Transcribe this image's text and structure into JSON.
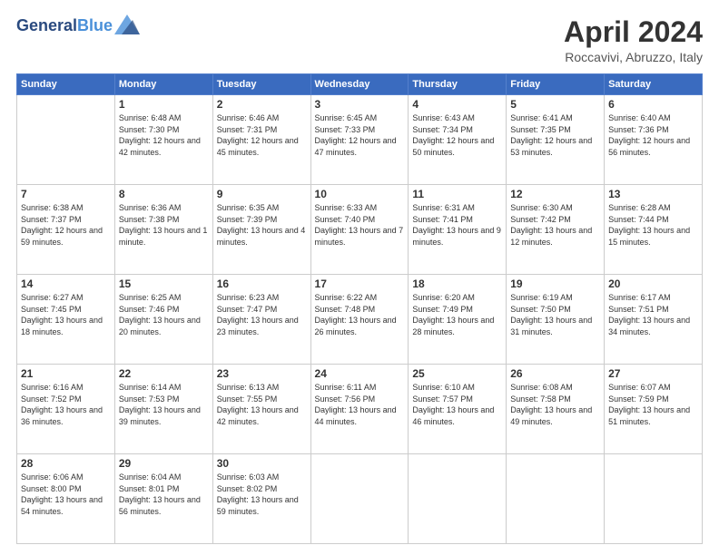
{
  "header": {
    "logo_line1": "General",
    "logo_line2": "Blue",
    "title": "April 2024",
    "location": "Roccavivi, Abruzzo, Italy"
  },
  "weekdays": [
    "Sunday",
    "Monday",
    "Tuesday",
    "Wednesday",
    "Thursday",
    "Friday",
    "Saturday"
  ],
  "weeks": [
    [
      {
        "day": "",
        "sunrise": "",
        "sunset": "",
        "daylight": ""
      },
      {
        "day": "1",
        "sunrise": "Sunrise: 6:48 AM",
        "sunset": "Sunset: 7:30 PM",
        "daylight": "Daylight: 12 hours and 42 minutes."
      },
      {
        "day": "2",
        "sunrise": "Sunrise: 6:46 AM",
        "sunset": "Sunset: 7:31 PM",
        "daylight": "Daylight: 12 hours and 45 minutes."
      },
      {
        "day": "3",
        "sunrise": "Sunrise: 6:45 AM",
        "sunset": "Sunset: 7:33 PM",
        "daylight": "Daylight: 12 hours and 47 minutes."
      },
      {
        "day": "4",
        "sunrise": "Sunrise: 6:43 AM",
        "sunset": "Sunset: 7:34 PM",
        "daylight": "Daylight: 12 hours and 50 minutes."
      },
      {
        "day": "5",
        "sunrise": "Sunrise: 6:41 AM",
        "sunset": "Sunset: 7:35 PM",
        "daylight": "Daylight: 12 hours and 53 minutes."
      },
      {
        "day": "6",
        "sunrise": "Sunrise: 6:40 AM",
        "sunset": "Sunset: 7:36 PM",
        "daylight": "Daylight: 12 hours and 56 minutes."
      }
    ],
    [
      {
        "day": "7",
        "sunrise": "Sunrise: 6:38 AM",
        "sunset": "Sunset: 7:37 PM",
        "daylight": "Daylight: 12 hours and 59 minutes."
      },
      {
        "day": "8",
        "sunrise": "Sunrise: 6:36 AM",
        "sunset": "Sunset: 7:38 PM",
        "daylight": "Daylight: 13 hours and 1 minute."
      },
      {
        "day": "9",
        "sunrise": "Sunrise: 6:35 AM",
        "sunset": "Sunset: 7:39 PM",
        "daylight": "Daylight: 13 hours and 4 minutes."
      },
      {
        "day": "10",
        "sunrise": "Sunrise: 6:33 AM",
        "sunset": "Sunset: 7:40 PM",
        "daylight": "Daylight: 13 hours and 7 minutes."
      },
      {
        "day": "11",
        "sunrise": "Sunrise: 6:31 AM",
        "sunset": "Sunset: 7:41 PM",
        "daylight": "Daylight: 13 hours and 9 minutes."
      },
      {
        "day": "12",
        "sunrise": "Sunrise: 6:30 AM",
        "sunset": "Sunset: 7:42 PM",
        "daylight": "Daylight: 13 hours and 12 minutes."
      },
      {
        "day": "13",
        "sunrise": "Sunrise: 6:28 AM",
        "sunset": "Sunset: 7:44 PM",
        "daylight": "Daylight: 13 hours and 15 minutes."
      }
    ],
    [
      {
        "day": "14",
        "sunrise": "Sunrise: 6:27 AM",
        "sunset": "Sunset: 7:45 PM",
        "daylight": "Daylight: 13 hours and 18 minutes."
      },
      {
        "day": "15",
        "sunrise": "Sunrise: 6:25 AM",
        "sunset": "Sunset: 7:46 PM",
        "daylight": "Daylight: 13 hours and 20 minutes."
      },
      {
        "day": "16",
        "sunrise": "Sunrise: 6:23 AM",
        "sunset": "Sunset: 7:47 PM",
        "daylight": "Daylight: 13 hours and 23 minutes."
      },
      {
        "day": "17",
        "sunrise": "Sunrise: 6:22 AM",
        "sunset": "Sunset: 7:48 PM",
        "daylight": "Daylight: 13 hours and 26 minutes."
      },
      {
        "day": "18",
        "sunrise": "Sunrise: 6:20 AM",
        "sunset": "Sunset: 7:49 PM",
        "daylight": "Daylight: 13 hours and 28 minutes."
      },
      {
        "day": "19",
        "sunrise": "Sunrise: 6:19 AM",
        "sunset": "Sunset: 7:50 PM",
        "daylight": "Daylight: 13 hours and 31 minutes."
      },
      {
        "day": "20",
        "sunrise": "Sunrise: 6:17 AM",
        "sunset": "Sunset: 7:51 PM",
        "daylight": "Daylight: 13 hours and 34 minutes."
      }
    ],
    [
      {
        "day": "21",
        "sunrise": "Sunrise: 6:16 AM",
        "sunset": "Sunset: 7:52 PM",
        "daylight": "Daylight: 13 hours and 36 minutes."
      },
      {
        "day": "22",
        "sunrise": "Sunrise: 6:14 AM",
        "sunset": "Sunset: 7:53 PM",
        "daylight": "Daylight: 13 hours and 39 minutes."
      },
      {
        "day": "23",
        "sunrise": "Sunrise: 6:13 AM",
        "sunset": "Sunset: 7:55 PM",
        "daylight": "Daylight: 13 hours and 42 minutes."
      },
      {
        "day": "24",
        "sunrise": "Sunrise: 6:11 AM",
        "sunset": "Sunset: 7:56 PM",
        "daylight": "Daylight: 13 hours and 44 minutes."
      },
      {
        "day": "25",
        "sunrise": "Sunrise: 6:10 AM",
        "sunset": "Sunset: 7:57 PM",
        "daylight": "Daylight: 13 hours and 46 minutes."
      },
      {
        "day": "26",
        "sunrise": "Sunrise: 6:08 AM",
        "sunset": "Sunset: 7:58 PM",
        "daylight": "Daylight: 13 hours and 49 minutes."
      },
      {
        "day": "27",
        "sunrise": "Sunrise: 6:07 AM",
        "sunset": "Sunset: 7:59 PM",
        "daylight": "Daylight: 13 hours and 51 minutes."
      }
    ],
    [
      {
        "day": "28",
        "sunrise": "Sunrise: 6:06 AM",
        "sunset": "Sunset: 8:00 PM",
        "daylight": "Daylight: 13 hours and 54 minutes."
      },
      {
        "day": "29",
        "sunrise": "Sunrise: 6:04 AM",
        "sunset": "Sunset: 8:01 PM",
        "daylight": "Daylight: 13 hours and 56 minutes."
      },
      {
        "day": "30",
        "sunrise": "Sunrise: 6:03 AM",
        "sunset": "Sunset: 8:02 PM",
        "daylight": "Daylight: 13 hours and 59 minutes."
      },
      {
        "day": "",
        "sunrise": "",
        "sunset": "",
        "daylight": ""
      },
      {
        "day": "",
        "sunrise": "",
        "sunset": "",
        "daylight": ""
      },
      {
        "day": "",
        "sunrise": "",
        "sunset": "",
        "daylight": ""
      },
      {
        "day": "",
        "sunrise": "",
        "sunset": "",
        "daylight": ""
      }
    ]
  ]
}
